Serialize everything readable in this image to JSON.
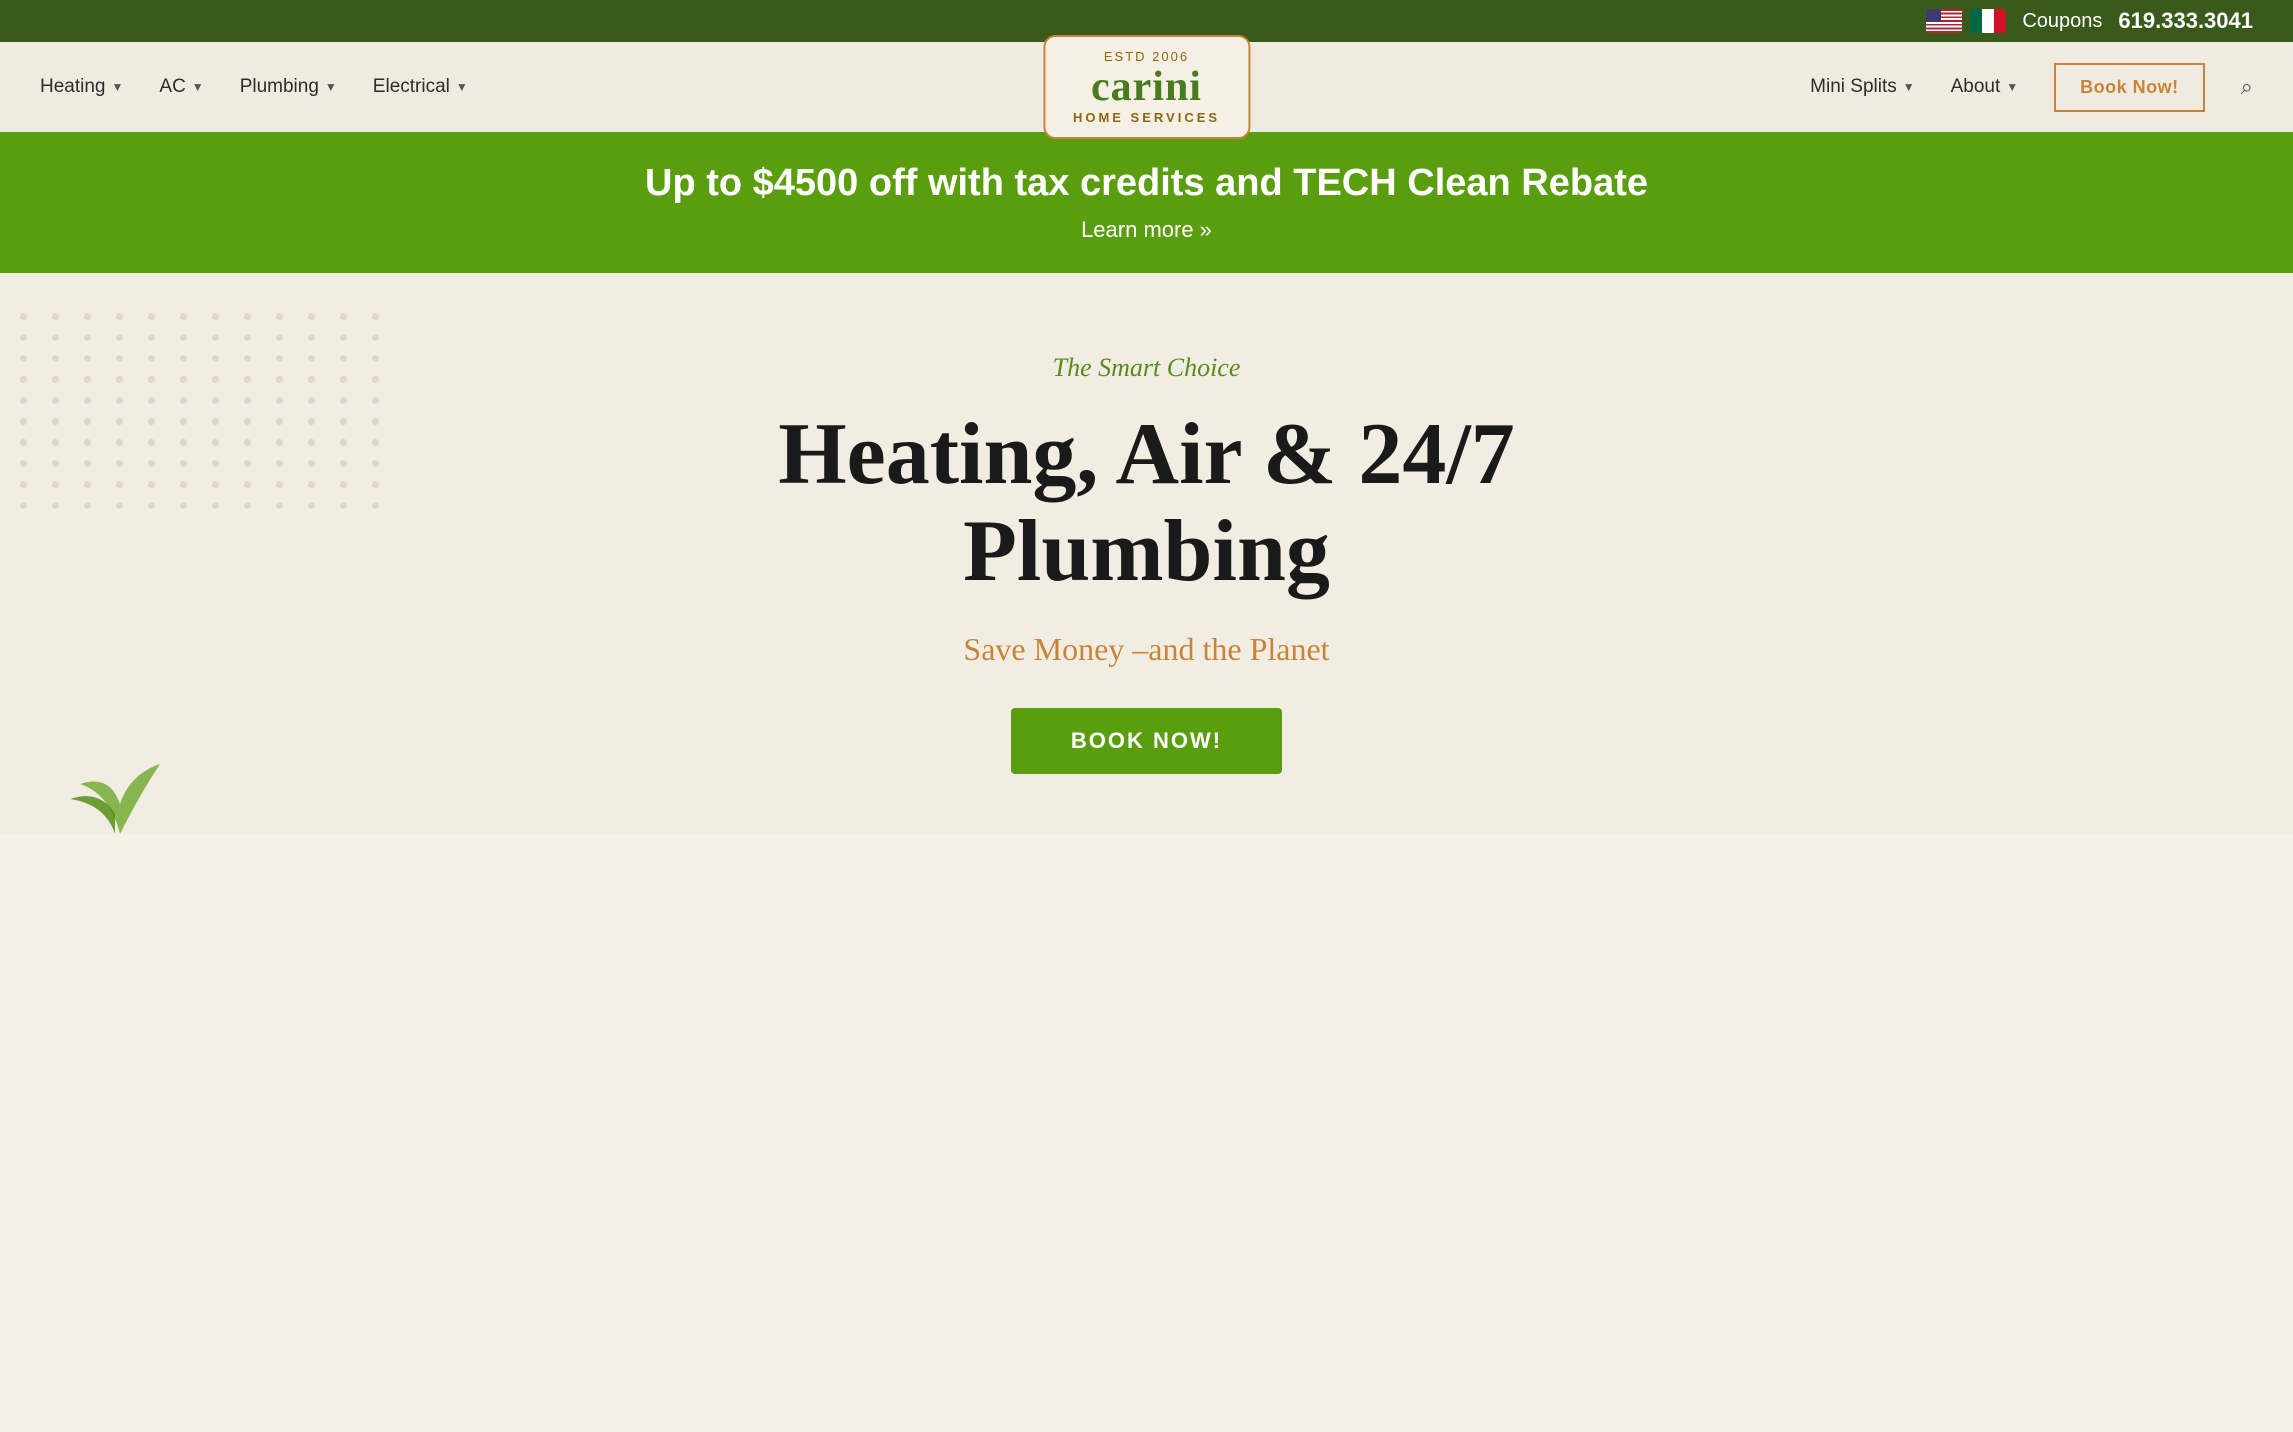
{
  "topbar": {
    "coupons_label": "Coupons",
    "phone": "619.333.3041"
  },
  "logo": {
    "est": "ESTD 2006",
    "name": "carini",
    "subtitle": "HOME SERVICES"
  },
  "nav": {
    "left_items": [
      {
        "label": "Heating",
        "has_dropdown": true
      },
      {
        "label": "AC",
        "has_dropdown": true
      },
      {
        "label": "Plumbing",
        "has_dropdown": true
      },
      {
        "label": "Electrical",
        "has_dropdown": true
      }
    ],
    "right_items": [
      {
        "label": "Mini Splits",
        "has_dropdown": true
      },
      {
        "label": "About",
        "has_dropdown": true
      }
    ],
    "book_now": "Book Now!"
  },
  "promo": {
    "title": "Up to $4500 off with tax credits and TECH Clean Rebate",
    "link_label": "Learn more »"
  },
  "hero": {
    "tagline": "The Smart Choice",
    "title_line1": "Heating, Air & 24/7",
    "title_line2": "Plumbing",
    "subtitle": "Save Money –and the Planet",
    "cta_button": "BOOK NOW!"
  }
}
